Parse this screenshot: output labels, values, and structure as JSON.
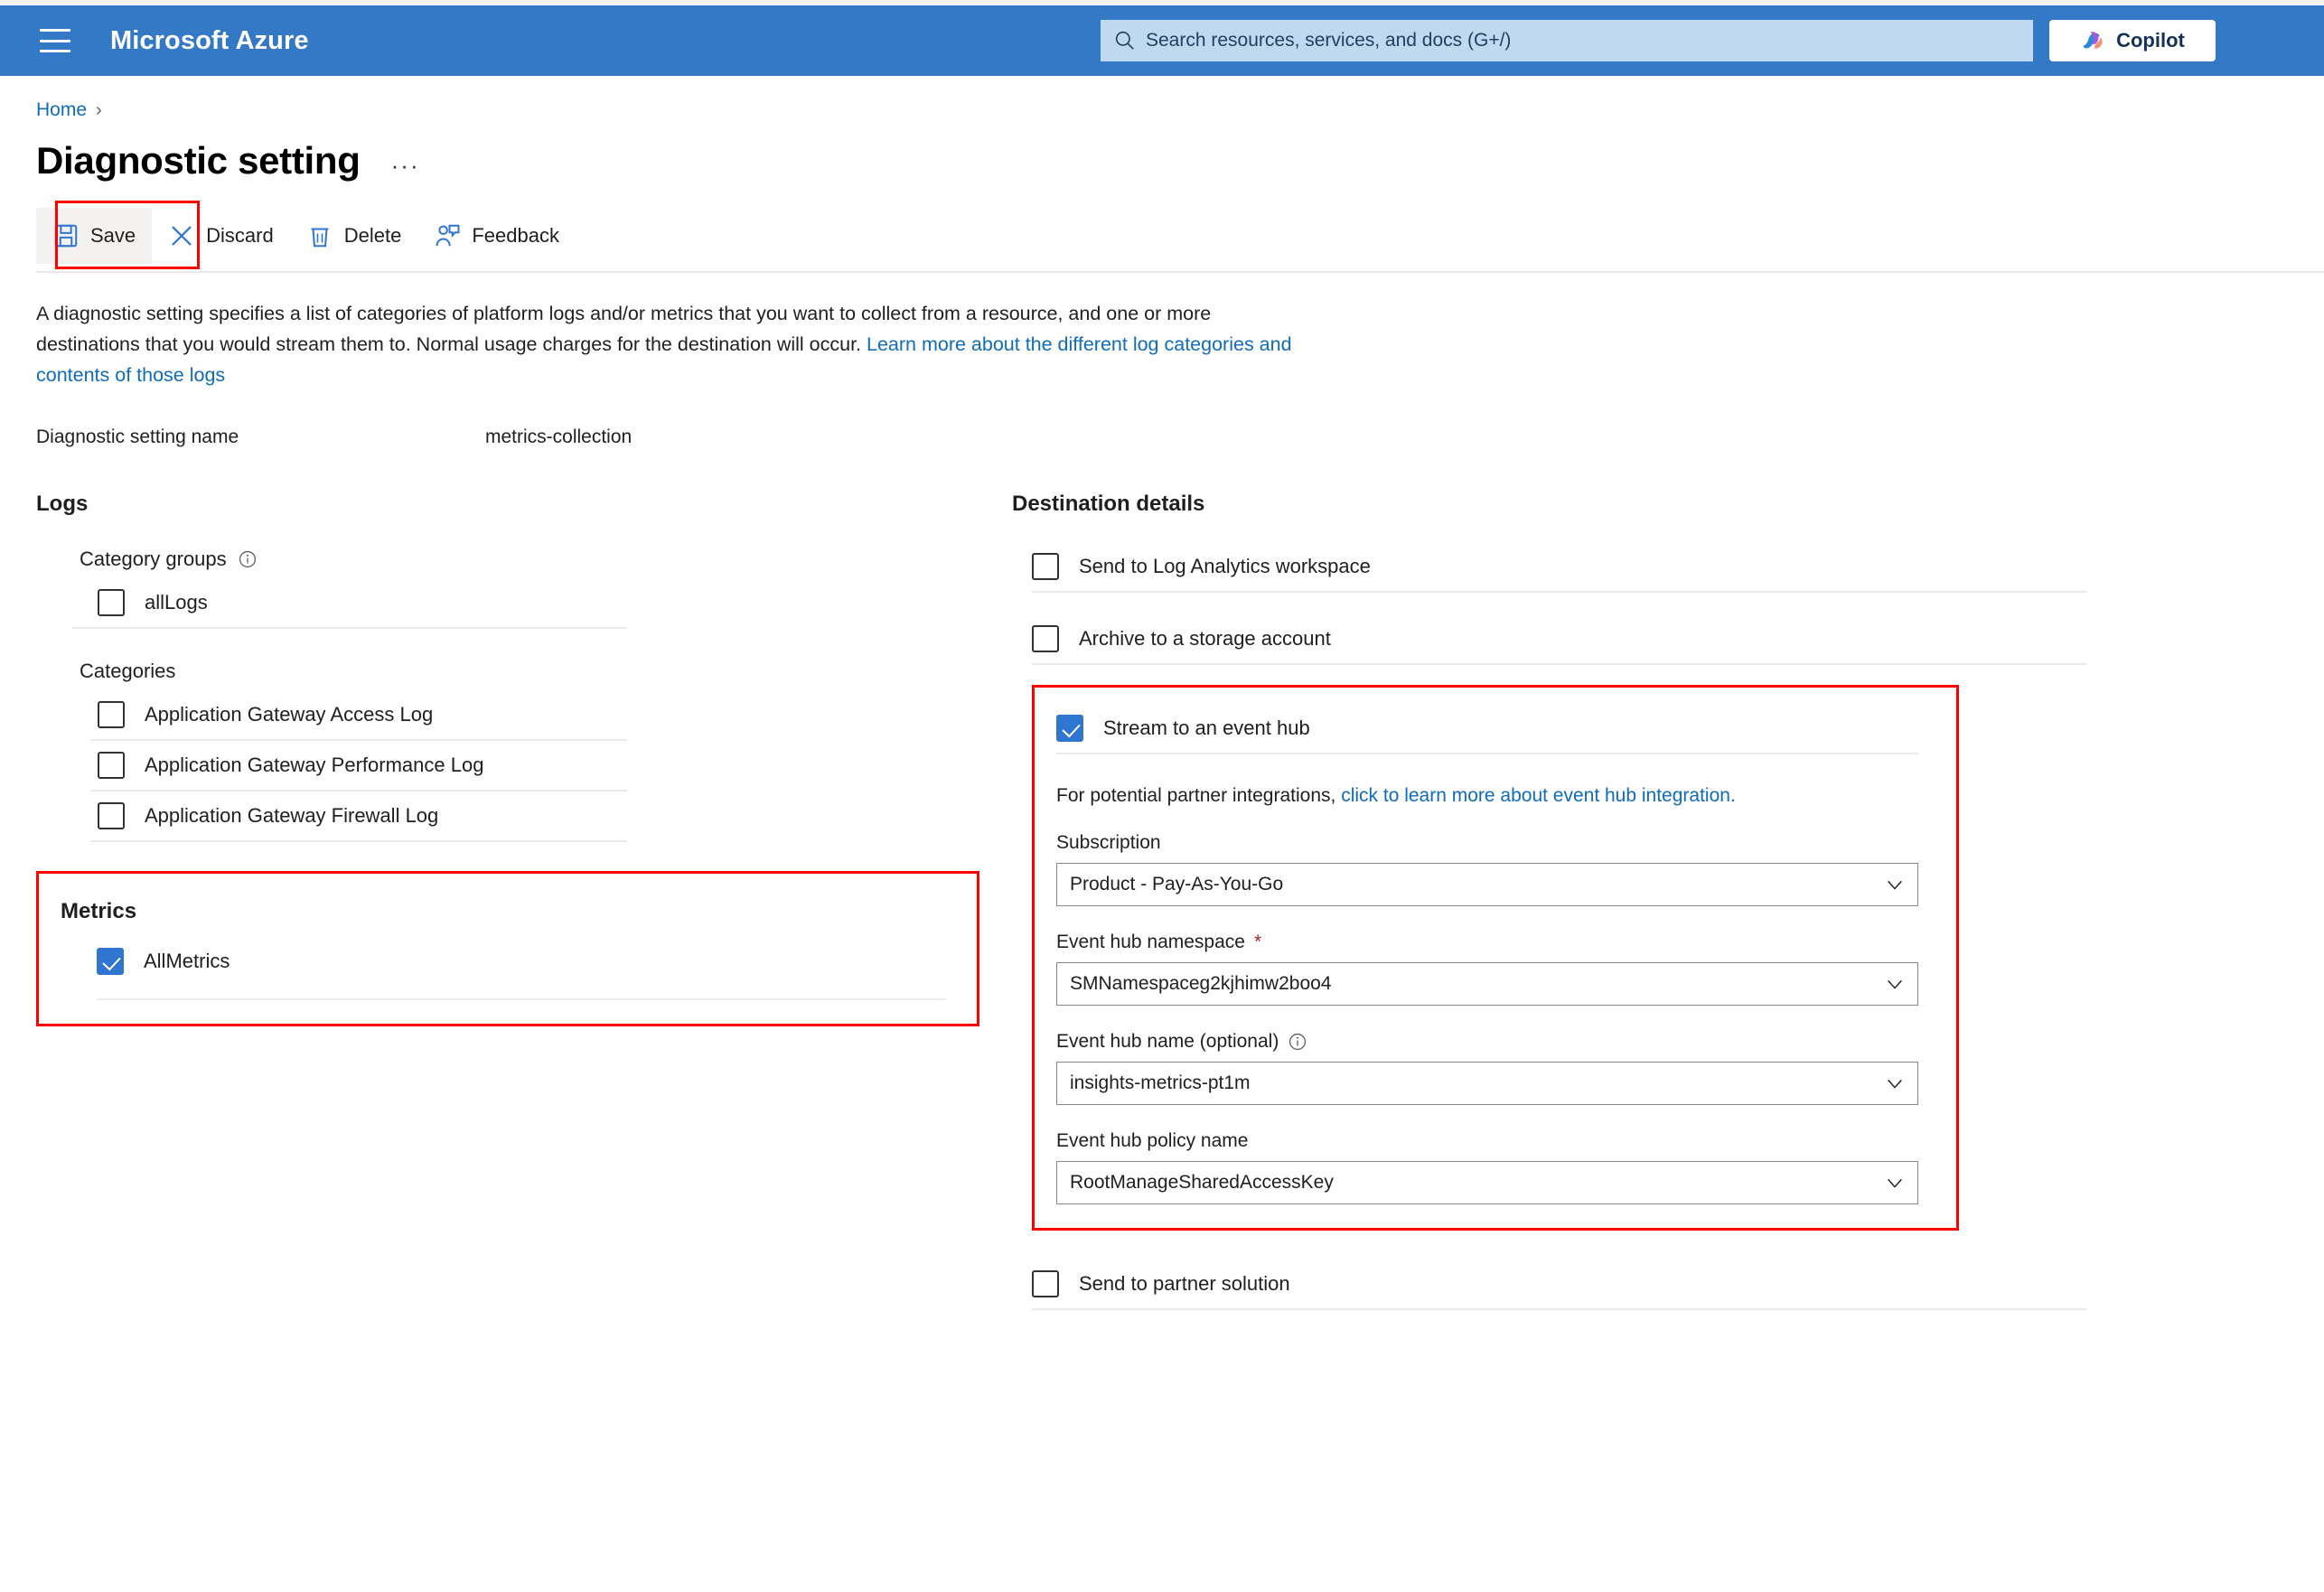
{
  "topbar": {
    "brand": "Microsoft Azure",
    "search_placeholder": "Search resources, services, and docs (G+/)",
    "search_value": "",
    "copilot_label": "Copilot"
  },
  "breadcrumb": {
    "home": "Home",
    "separator": "›"
  },
  "header": {
    "title": "Diagnostic setting",
    "more_menu": "···"
  },
  "toolbar": {
    "save_label": "Save",
    "discard_label": "Discard",
    "delete_label": "Delete",
    "feedback_label": "Feedback"
  },
  "description": {
    "text_part1": "A diagnostic setting specifies a list of categories of platform logs and/or metrics that you want to collect from a resource, and one or more destinations that you would stream them to. Normal usage charges for the destination will occur. ",
    "link_text": "Learn more about the different log categories and contents of those logs"
  },
  "setting_name": {
    "label": "Diagnostic setting name",
    "value": "metrics-collection"
  },
  "logs": {
    "section_title": "Logs",
    "category_groups_label": "Category groups",
    "category_groups_info_icon": "info-icon",
    "category_groups": [
      {
        "label": "allLogs",
        "checked": false
      }
    ],
    "categories_label": "Categories",
    "categories": [
      {
        "label": "Application Gateway Access Log",
        "checked": false
      },
      {
        "label": "Application Gateway Performance Log",
        "checked": false
      },
      {
        "label": "Application Gateway Firewall Log",
        "checked": false
      }
    ]
  },
  "metrics": {
    "section_title": "Metrics",
    "items": [
      {
        "label": "AllMetrics",
        "checked": true
      }
    ],
    "highlight_color": "#ff0000"
  },
  "destination": {
    "section_title": "Destination details",
    "log_analytics": {
      "label": "Send to Log Analytics workspace",
      "checked": false
    },
    "storage_account": {
      "label": "Archive to a storage account",
      "checked": false
    },
    "event_hub": {
      "label": "Stream to an event hub",
      "checked": true,
      "note_prefix": "For potential partner integrations, ",
      "note_link": "click to learn more about event hub integration.",
      "fields": [
        {
          "label": "Subscription",
          "required": false,
          "has_info": false,
          "value": "Product - Pay-As-You-Go"
        },
        {
          "label": "Event hub namespace",
          "required": true,
          "has_info": false,
          "value": "SMNamespaceg2kjhimw2boo4"
        },
        {
          "label": "Event hub name (optional)",
          "required": false,
          "has_info": true,
          "value": "insights-metrics-pt1m"
        },
        {
          "label": "Event hub policy name",
          "required": false,
          "has_info": false,
          "value": "RootManageSharedAccessKey"
        }
      ],
      "highlight_color": "#ff0000"
    },
    "partner_solution": {
      "label": "Send to partner solution",
      "checked": false
    }
  },
  "colors": {
    "azure_blue": "#3379c6",
    "link_blue": "#0f6cbd",
    "checkbox_blue": "#2f76d0",
    "highlight_red": "#ff0000"
  }
}
